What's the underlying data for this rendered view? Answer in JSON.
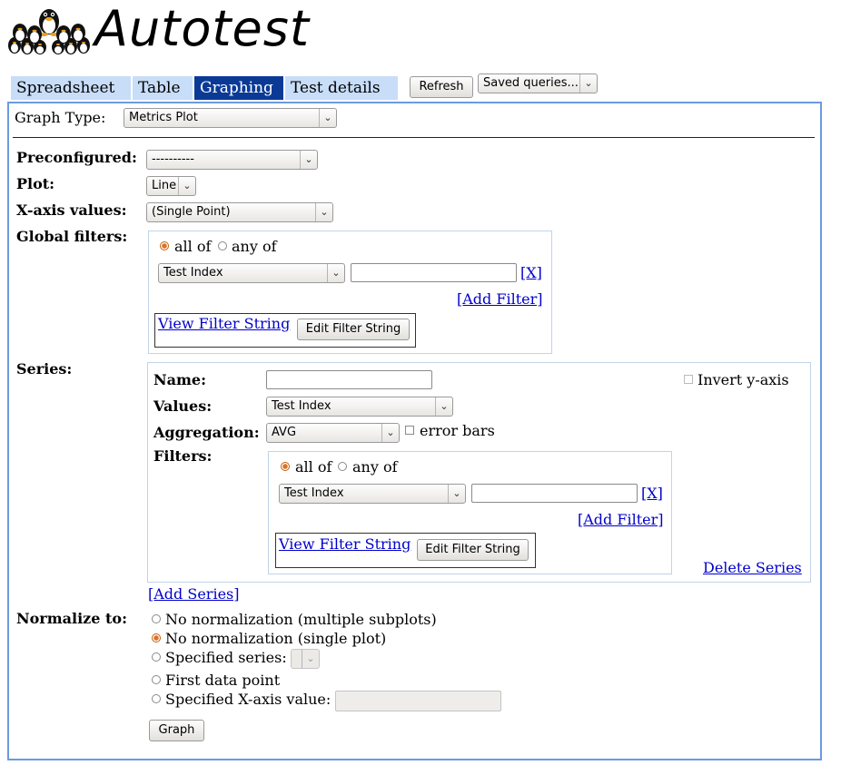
{
  "app": {
    "title": "Autotest"
  },
  "tabs": [
    {
      "label": "Spreadsheet"
    },
    {
      "label": "Table"
    },
    {
      "label": "Graphing"
    },
    {
      "label": "Test details"
    }
  ],
  "toolbar": {
    "refresh_label": "Refresh",
    "saved_queries_label": "Saved queries..."
  },
  "graph_type": {
    "label": "Graph Type:",
    "value": "Metrics Plot"
  },
  "form": {
    "preconfigured": {
      "label": "Preconfigured:",
      "value": "----------"
    },
    "plot": {
      "label": "Plot:",
      "value": "Line"
    },
    "xaxis": {
      "label": "X-axis values:",
      "value": "(Single Point)"
    },
    "global_filters": {
      "label": "Global filters:",
      "all_of": "all of",
      "any_of": "any of",
      "field": "Test Index",
      "value": "",
      "remove": "[X]",
      "add_filter": "[Add Filter]",
      "view_filter_string": "View Filter String",
      "edit_filter_string": "Edit Filter String"
    },
    "series": {
      "label": "Series:",
      "name_label": "Name:",
      "name_value": "",
      "values_label": "Values:",
      "values_value": "Test Index",
      "aggregation_label": "Aggregation:",
      "aggregation_value": "AVG",
      "error_bars": "error bars",
      "invert_y": "Invert y-axis",
      "filters_label": "Filters:",
      "all_of": "all of",
      "any_of": "any of",
      "filter_field": "Test Index",
      "filter_value": "",
      "remove": "[X]",
      "add_filter": "[Add Filter]",
      "view_filter_string": "View Filter String",
      "edit_filter_string": "Edit Filter String",
      "delete_series": "Delete Series",
      "add_series": "[Add Series]"
    },
    "normalize": {
      "label": "Normalize to:",
      "options": [
        "No normalization (multiple subplots)",
        "No normalization (single plot)",
        "Specified series:",
        "First data point",
        "Specified X-axis value:"
      ],
      "selected_index": 1
    },
    "graph_button": "Graph"
  },
  "colors": {
    "active_tab": "#0a3a96",
    "tab": "#c8ddf8",
    "panel_border": "#6a9be0",
    "link": "#0000cc"
  }
}
